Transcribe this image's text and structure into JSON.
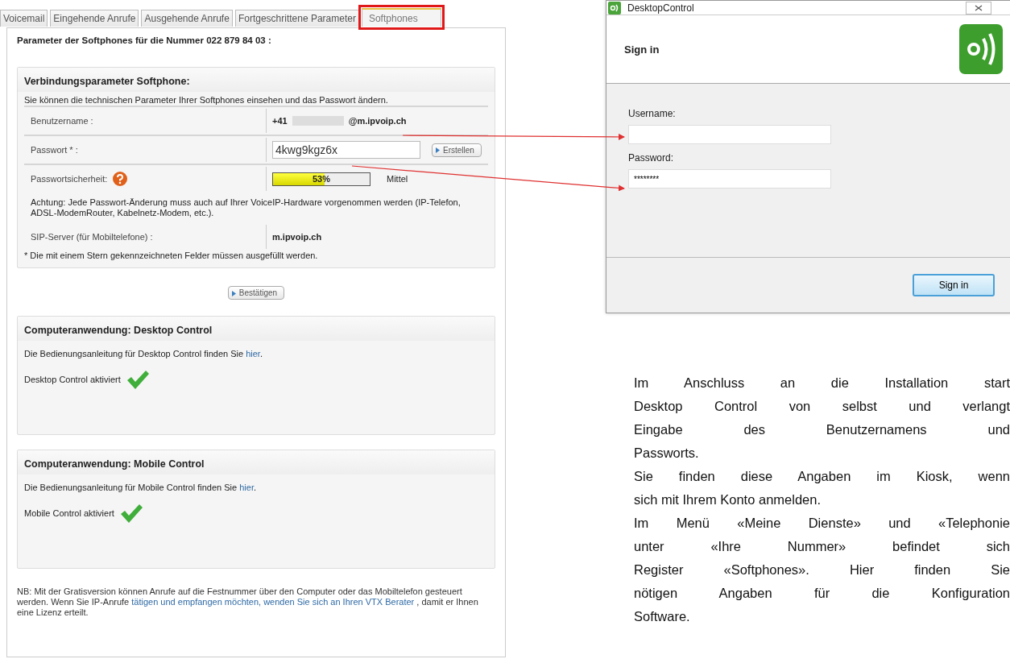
{
  "tabs": [
    {
      "label": "Voicemail",
      "selected": false,
      "highlighted": false
    },
    {
      "label": "Eingehende Anrufe",
      "selected": false,
      "highlighted": false
    },
    {
      "label": "Ausgehende Anrufe",
      "selected": false,
      "highlighted": false
    },
    {
      "label": "Fortgeschrittene Parameter",
      "selected": false,
      "highlighted": false
    },
    {
      "label": "Softphones",
      "selected": true,
      "highlighted": true
    }
  ],
  "heading": "Parameter der Softphones für die Nummer 022 879 84 03 :",
  "connection": {
    "title": "Verbindungsparameter Softphone:",
    "intro": "Sie können die technischen Parameter Ihrer Softphones einsehen und das Passwort ändern.",
    "username": {
      "label": "Benutzername :",
      "prefix": "+41",
      "suffix": "@m.ipvoip.ch"
    },
    "password": {
      "label": "Passwort * :",
      "value": "4kwg9kgz6x",
      "button": "Erstellen"
    },
    "strength": {
      "label": "Passwortsicherheit:",
      "level": 0.53,
      "reading": "53%",
      "rating": "Mittel"
    },
    "warning": "Achtung: Jede Passwort-Änderung muss auch auf Ihrer VoiceIP-Hardware vorgenommen werden (IP-Telefon, ADSL-ModemRouter, Kabelnetz-Modem, etc.).",
    "sip": {
      "label": "SIP-Server (für Mobiltelefone) :",
      "value": "m.ipvoip.ch"
    },
    "note": "* Die mit einem Stern gekennzeichneten Felder müssen ausgefüllt werden."
  },
  "confirm_button": "Bestätigen",
  "apps": [
    {
      "title": "Computeranwendung: Desktop Control",
      "manual": "Die Bedienungsanleitung für Desktop Control finden Sie",
      "link": "hier",
      "after": ".",
      "status": "Desktop Control aktiviert",
      "activated": true
    },
    {
      "title": "Computeranwendung: Mobile Control",
      "manual": "Die Bedienungsanleitung für Mobile Control finden Sie",
      "link": "hier",
      "after": ".",
      "status": "Mobile Control aktiviert",
      "activated": true
    }
  ],
  "nb": {
    "before": "NB: Mit der Gratisversion können Anrufe auf die Festnummer über den Computer oder das Mobiltelefon gesteuert werden. Wenn Sie IP-Anrufe",
    "link": "tätigen und empfangen möchten, wenden Sie sich an Ihren VTX Berater",
    "after": ", damit er Ihnen eine Lizenz erteilt."
  },
  "window": {
    "title": "DesktopControl",
    "heading": "Sign in",
    "fields": [
      {
        "label": "Username:"
      },
      {
        "label": "Password:",
        "value": "********"
      }
    ],
    "button": "Sign in"
  },
  "paragraphs": [
    {
      "lines": [
        "Im Anschluss an die Installation start",
        "Desktop Control von selbst und verlangt",
        "Eingabe des Benutzernamens und",
        "Passworts."
      ]
    },
    {
      "lines": [
        "Sie finden diese Angaben im Kiosk, wenn",
        "sich mit Ihrem Konto anmelden."
      ]
    },
    {
      "lines": [
        "Im Menü «Meine Dienste» und «Telephonie",
        "unter «Ihre Nummer» befindet sich",
        "Register «Softphones». Hier finden Sie",
        "nötigen Angaben für die Konfiguration",
        "Software."
      ]
    }
  ]
}
